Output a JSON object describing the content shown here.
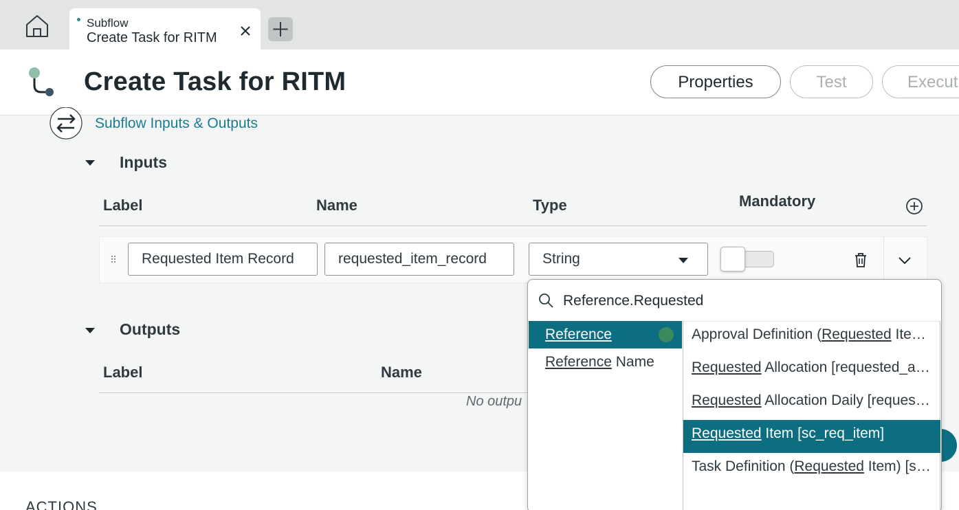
{
  "tabs": {
    "home_icon": "home-icon",
    "active": {
      "kind": "Subflow",
      "title": "Create Task for RITM",
      "close_icon": "close-icon"
    },
    "add_icon": "plus-icon"
  },
  "header": {
    "title": "Create Task for RITM",
    "buttons": {
      "properties": "Properties",
      "test": "Test",
      "execute": "Execut"
    }
  },
  "section": {
    "title": "Subflow Inputs & Outputs"
  },
  "inputs": {
    "label": "Inputs",
    "columns": {
      "label": "Label",
      "name": "Name",
      "type": "Type",
      "mandatory": "Mandatory"
    },
    "rows": [
      {
        "label": "Requested Item Record",
        "name": "requested_item_record",
        "type": "String",
        "mandatory": false
      }
    ]
  },
  "outputs": {
    "label": "Outputs",
    "columns": {
      "label": "Label",
      "name": "Name"
    },
    "empty_text": "No outpu"
  },
  "actions": {
    "label": "ACTIONS"
  },
  "type_dropdown": {
    "search_value": "Reference.Requested",
    "categories": [
      {
        "match": "Reference",
        "rest": "",
        "active": true
      },
      {
        "match": "Reference",
        "rest": " Name",
        "active": false
      }
    ],
    "items": [
      {
        "pre": "Approval Definition (",
        "match": "Requested",
        "post": " Item) [sys_approval_definition]",
        "active": false
      },
      {
        "pre": "",
        "match": "Requested",
        "post": " Allocation [requested_allocation]",
        "active": false
      },
      {
        "pre": "",
        "match": "Requested",
        "post": " Allocation Daily [requested_allocation_daily]",
        "active": false
      },
      {
        "pre": "",
        "match": "Requested",
        "post": " Item [sc_req_item]",
        "active": true
      },
      {
        "pre": "Task Definition (",
        "match": "Requested",
        "post": " Item) [sc_task_definition]",
        "active": false
      }
    ]
  },
  "colors": {
    "accent": "#0d6e82",
    "link": "#1b7c8f",
    "status_dot": "#2d8a7b"
  }
}
